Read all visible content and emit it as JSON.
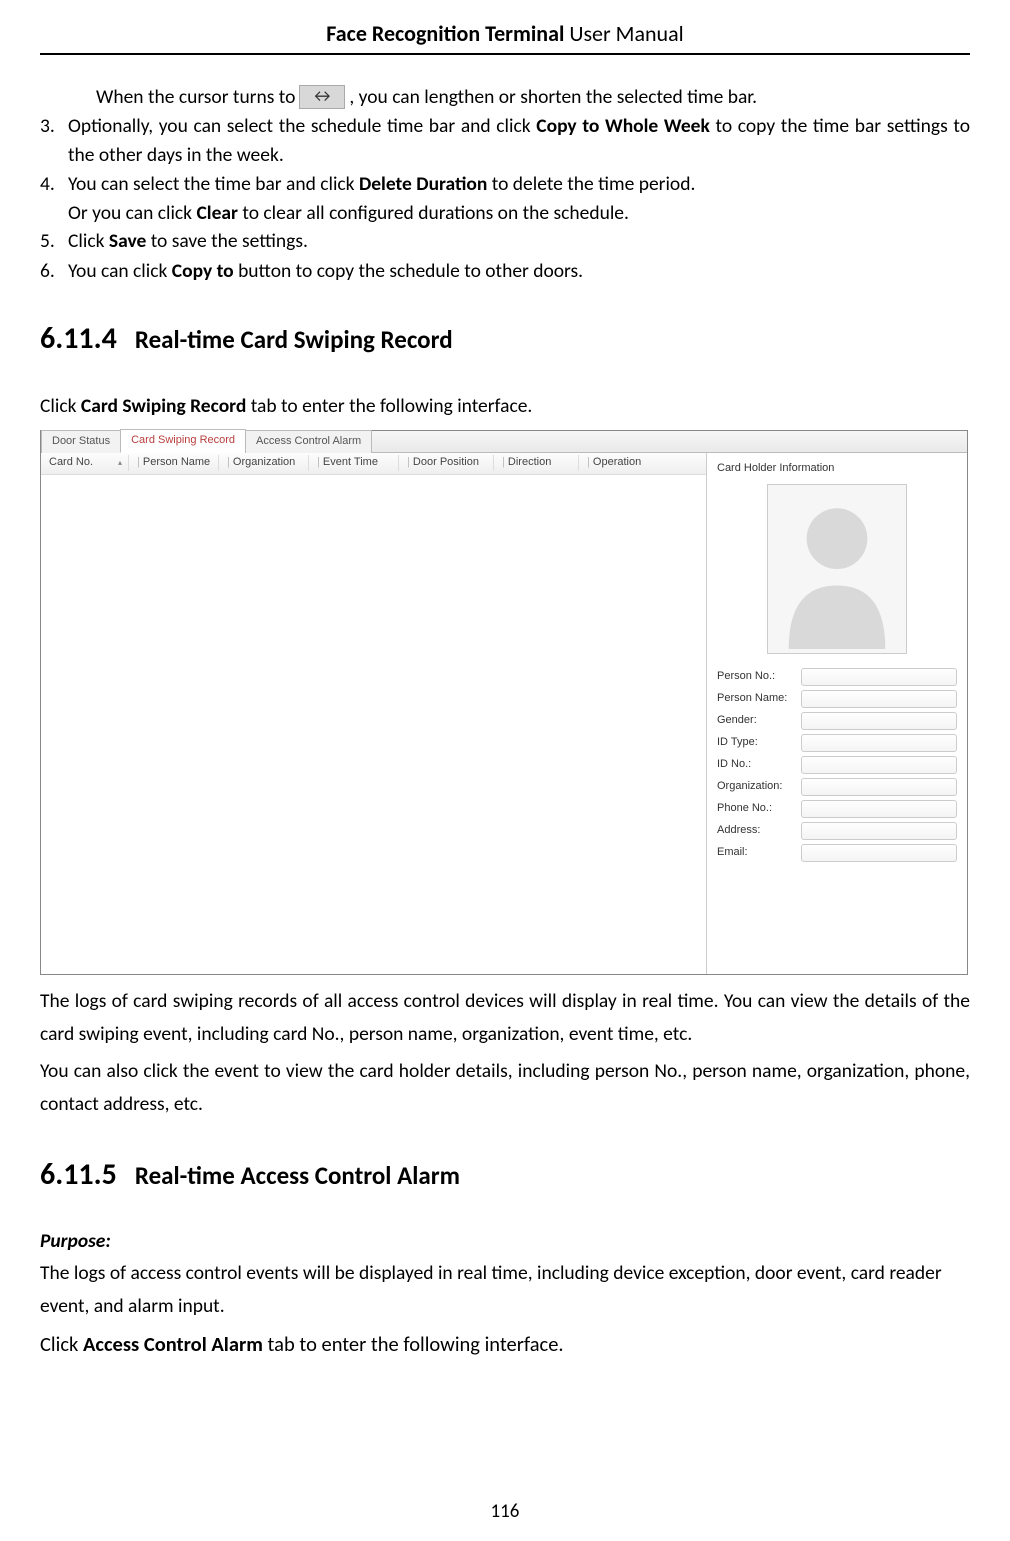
{
  "header": {
    "bold": "Face Recognition Terminal",
    "thin": " User Manual"
  },
  "intro_line_prefix": "When the cursor turns to ",
  "intro_line_suffix": ", you can lengthen or shorten the selected time bar.",
  "ol": [
    {
      "num": "3.",
      "text_parts": [
        "Optionally, you can select the schedule time bar and click ",
        "Copy to Whole Week",
        " to copy the time bar settings to the other days in the week."
      ]
    },
    {
      "num": "4.",
      "text_parts": [
        "You can select the time bar and click ",
        "Delete Duration",
        " to delete the time period."
      ],
      "sub": [
        "Or you can click ",
        "Clear",
        " to clear all configured durations on the schedule."
      ]
    },
    {
      "num": "5.",
      "text_parts": [
        "Click ",
        "Save",
        " to save the settings."
      ]
    },
    {
      "num": "6.",
      "text_parts": [
        "You can click ",
        "Copy to",
        " button to copy the schedule to other doors."
      ]
    }
  ],
  "section1": {
    "num": "6.11.4",
    "title": "Real-time Card Swiping Record"
  },
  "section1_intro": [
    "Click ",
    "Card Swiping Record",
    " tab to enter the following interface."
  ],
  "figure": {
    "tabs": [
      "Door Status",
      "Card Swiping Record",
      "Access Control Alarm"
    ],
    "active_tab_index": 1,
    "columns": [
      "Card No.",
      "Person Name",
      "Organization",
      "Event Time",
      "Door Position",
      "Direction",
      "Operation"
    ],
    "right_title": "Card Holder Information",
    "info_labels": [
      "Person No.:",
      "Person Name:",
      "Gender:",
      "ID Type:",
      "ID No.:",
      "Organization:",
      "Phone No.:",
      "Address:",
      "Email:"
    ]
  },
  "section1_after": [
    "The logs of card swiping records of all access control devices will display in real time. You can view the details of the card swiping event, including card No., person name, organization, event time, etc.",
    "You can also click the event to view the card holder details, including person No., person name, organization, phone, contact address, etc."
  ],
  "section2": {
    "num": "6.11.5",
    "title": "Real-time Access Control Alarm"
  },
  "section2_purpose_label": "Purpose:",
  "section2_purpose_text": "The logs of access control events will be displayed in real time, including device exception, door event, card reader event, and alarm input.",
  "section2_instruction": [
    "Click ",
    "Access Control Alarm",
    " tab to enter the following interface."
  ],
  "page_number": "116"
}
